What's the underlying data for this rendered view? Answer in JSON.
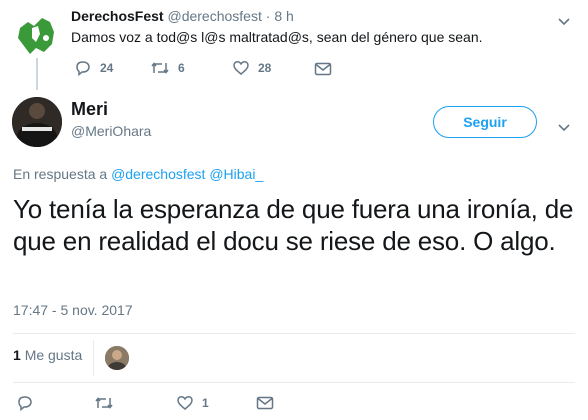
{
  "prev_tweet": {
    "display_name": "DerechosFest",
    "handle": "@derechosfest",
    "separator": "·",
    "time": "8 h",
    "text": "Damos voz a tod@s l@s maltratad@s, sean del género que sean.",
    "replies": "24",
    "retweets": "6",
    "likes": "28"
  },
  "tweet": {
    "display_name": "Meri",
    "handle": "@MeriOhara",
    "follow_label": "Seguir",
    "reply_prefix": "En respuesta a",
    "reply_to_1": "@derechosfest",
    "reply_to_2": "@Hibai_",
    "text": "Yo tenía la esperanza de que fuera una ironía, de que en realidad el docu se riese de eso. O algo.",
    "timestamp": "17:47 - 5 nov. 2017",
    "likes_count": "1",
    "likes_label": "Me gusta",
    "bottom_likes": "1"
  },
  "colors": {
    "accent": "#1da1f2",
    "muted": "#657786",
    "green": "#3a9a3a"
  }
}
